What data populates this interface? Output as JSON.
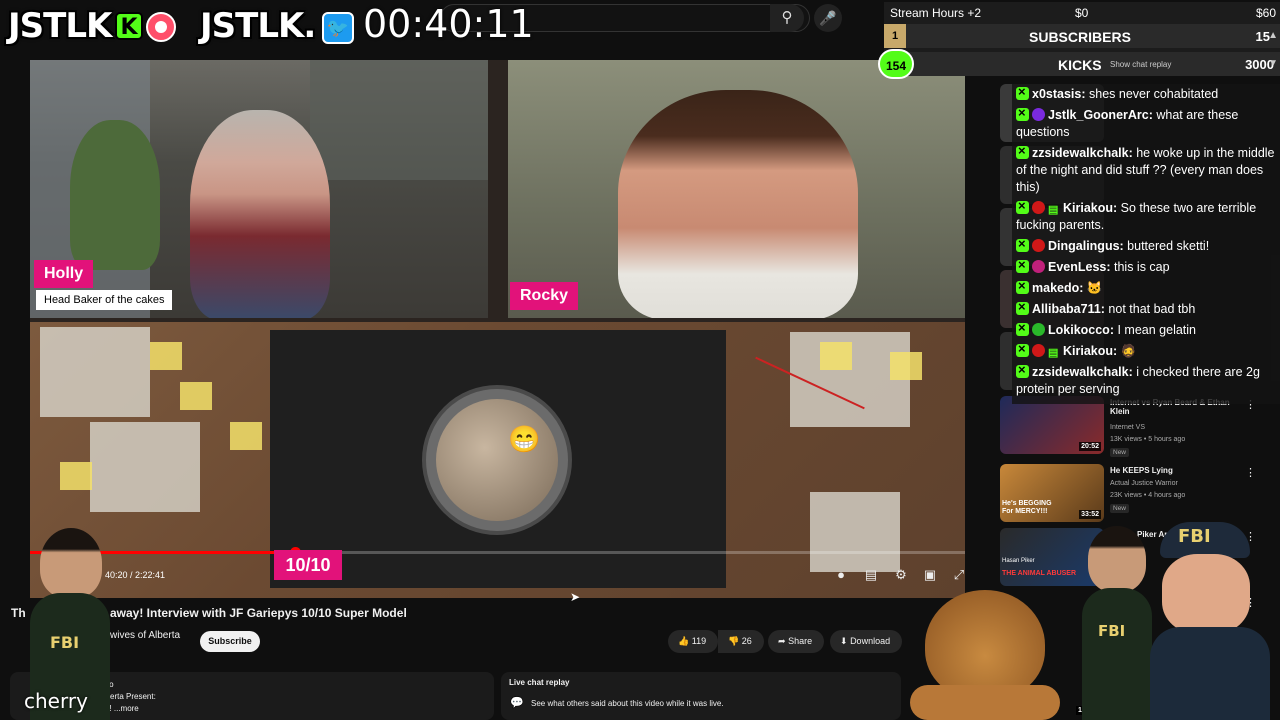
{
  "brand": {
    "left_text": "JSTLK",
    "right_text": "JSTLK.",
    "kick_letter": "K"
  },
  "stream_timer": "00:40:11",
  "stats": {
    "stream_hours": "Stream Hours +2",
    "dollar_start": "$0",
    "dollar_goal": "$60",
    "subscribers": {
      "count": "1",
      "label": "SUBSCRIBERS",
      "target": "15"
    },
    "kicks": {
      "count": "154",
      "label": "KICKS",
      "target": "3000"
    },
    "show_chat_replay": "Show chat replay"
  },
  "chat": [
    {
      "user": "x0stasis:",
      "text": " shes never cohabitated",
      "badges": [
        "kick"
      ]
    },
    {
      "user": "Jstlk_GoonerArc:",
      "text": " what are these questions",
      "badges": [
        "kick",
        "purple"
      ]
    },
    {
      "user": "zzsidewalkchalk:",
      "text": " he woke up in the middle of the night and did stuff ?? (every man does this)",
      "badges": [
        "kick"
      ]
    },
    {
      "user": "Kiriakou:",
      "text": " So these two are terrible fucking parents.",
      "badges": [
        "kick",
        "red",
        "gift"
      ]
    },
    {
      "user": "Dingalingus:",
      "text": " buttered sketti!",
      "badges": [
        "kick",
        "red"
      ]
    },
    {
      "user": "EvenLess:",
      "text": " this is cap",
      "badges": [
        "kick",
        "magenta"
      ]
    },
    {
      "user": "makedo:",
      "text": " 🐱",
      "badges": [
        "kick"
      ]
    },
    {
      "user": "Allibaba711:",
      "text": " not that bad tbh",
      "badges": [
        "kick"
      ]
    },
    {
      "user": "Lokikocco:",
      "text": " I mean gelatin",
      "badges": [
        "kick",
        "green"
      ]
    },
    {
      "user": "Kiriakou:",
      "text": " 🧔",
      "badges": [
        "kick",
        "red",
        "gift"
      ]
    },
    {
      "user": "zzsidewalkchalk:",
      "text": " i checked there are 2g protein per serving",
      "badges": [
        "kick"
      ]
    }
  ],
  "video": {
    "participants": [
      {
        "name": "Holly",
        "role": "Head Baker of the cakes"
      },
      {
        "name": "Rocky"
      }
    ],
    "time": "40:20 / 2:22:41",
    "progress_fraction": 0.283,
    "score": "10/10",
    "title_prefix": "Th",
    "title": "away! Interview with JF Gariepys 10/10 Super Model",
    "channel": "wives of Alberta",
    "subscribe": "Subscribe",
    "likes": "119",
    "dislikes": "26",
    "share": "Share",
    "download": "Download",
    "desc_line1": "ys ago",
    "desc_line2": "of Alberta Present:",
    "desc_line3": "Away! ...more",
    "live_chat_replay_title": "Live chat replay",
    "live_chat_replay_sub": "See what others said about this video while it was live."
  },
  "recommendations": [
    {
      "title": "Internet vs Ryan Beard & Ethan Klein",
      "channel": "Internet VS",
      "meta": "13K views • 5 hours ago",
      "badge": "New",
      "duration": "20:52"
    },
    {
      "title": "He KEEPS Lying",
      "channel": "Actual Justice Warrior",
      "meta": "23K views • 4 hours ago",
      "badge": "New",
      "duration": "33:52"
    },
    {
      "title": "Piker Anim... ns, Wo...",
      "channel": "",
      "meta": "",
      "badge": "",
      "duration": ""
    },
    {
      "title": "",
      "channel": "",
      "meta": "",
      "badge": "",
      "duration": "16:07"
    }
  ],
  "thumb_text": {
    "rec2_overlay": "He's BEGGING For MERCY!!!",
    "rec3_overlay": "THE ANIMAL ABUSER",
    "rec3_top": "Hasan Piker"
  },
  "streamer_name": "cherry",
  "mascot_labels": {
    "fbi": "FBI"
  },
  "colors": {
    "accent_pink": "#e2127a",
    "kick_green": "#53fc18",
    "yt_red": "#ff0000"
  }
}
